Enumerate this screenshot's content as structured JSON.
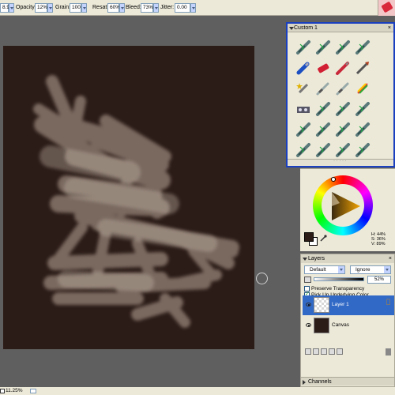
{
  "propbar": {
    "size_value": "8.9",
    "opacity_label": "Opacity:",
    "opacity_value": "12%",
    "grain_label": "Grain:",
    "grain_value": "100",
    "resat_label": "Resat:",
    "resat_value": "60%",
    "bleed_label": "Bleed:",
    "bleed_value": "73%",
    "jitter_label": "Jitter:",
    "jitter_value": "0.00"
  },
  "brush_panel": {
    "title": "Custom 1",
    "close": "×",
    "icons": [
      "pencil-brush-icon",
      "pencil-brush-icon",
      "pencil-brush-icon",
      "pencil-brush-icon",
      "blue-marker-icon",
      "red-eraser-icon",
      "red-pen-icon",
      "wedge-brush-icon",
      "star-brush-icon",
      "palette-knife-icon",
      "palette-knife-icon",
      "rainbow-brush-icon",
      "media-brush-icon",
      "pencil-brush-icon",
      "pencil-brush-icon",
      "pencil-brush-icon",
      "pencil-brush-icon",
      "pencil-brush-icon",
      "pencil-brush-icon",
      "pencil-brush-icon",
      "pencil-brush-icon",
      "pencil-brush-icon",
      "pencil-brush-icon",
      "pencil-brush-icon"
    ]
  },
  "color_panel": {
    "hsv_h": "H: 44%",
    "hsv_s": "S: 36%",
    "hsv_v": "V: 89%"
  },
  "layers": {
    "title": "Layers",
    "close": "×",
    "composite_method": "Default",
    "composite_depth": "Ignore",
    "opacity_value": "52%",
    "preserve_transparency": "Preserve Transparency",
    "pick_underlying": "Pick Up Underlying Color",
    "items": [
      {
        "name": "Layer 1"
      },
      {
        "name": "Canvas"
      }
    ]
  },
  "channels_label": "Channels",
  "status": {
    "zoom": "11.25%"
  },
  "colors": {
    "canvas": "#2c1c18",
    "stroke": "#b9a99a",
    "selected_layer": "#3169c6"
  }
}
